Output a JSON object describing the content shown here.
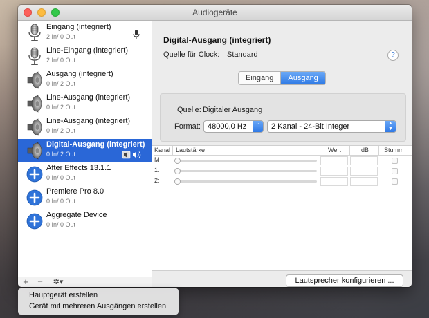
{
  "window": {
    "title": "Audiogeräte"
  },
  "devices": [
    {
      "name": "Eingang (integriert)",
      "io": "2 In/ 0 Out",
      "icon": "microphone-icon"
    },
    {
      "name": "Line-Eingang (integriert)",
      "io": "2 In/ 0 Out",
      "icon": "microphone-icon"
    },
    {
      "name": "Ausgang (integriert)",
      "io": "0 In/ 2 Out",
      "icon": "speaker-icon"
    },
    {
      "name": "Line-Ausgang (integriert)",
      "io": "0 In/ 2 Out",
      "icon": "speaker-icon"
    },
    {
      "name": "Line-Ausgang (integriert)",
      "io": "0 In/ 2 Out",
      "icon": "speaker-icon"
    },
    {
      "name": "Digital-Ausgang (integriert)",
      "io": "0 In/ 2 Out",
      "icon": "speaker-icon",
      "selected": true
    },
    {
      "name": "After Effects 13.1.1",
      "io": "0 In/ 0 Out",
      "icon": "plus-circle-icon"
    },
    {
      "name": "Premiere Pro 8.0",
      "io": "0 In/ 0 Out",
      "icon": "plus-circle-icon"
    },
    {
      "name": "Aggregate Device",
      "io": "0 In/ 0 Out",
      "icon": "plus-circle-icon"
    }
  ],
  "sidebar_bottom": {
    "add": "+",
    "remove": "−",
    "gear": "✲▾"
  },
  "detail": {
    "title": "Digital-Ausgang (integriert)",
    "clock_label": "Quelle für Clock:",
    "clock_value": "Standard",
    "help": "?",
    "tabs": [
      "Eingang",
      "Ausgang"
    ],
    "active_tab": "Ausgang",
    "source_label": "Quelle:",
    "source_value": "Digitaler Ausgang",
    "format_label": "Format:",
    "sample_rate": "48000,0 Hz",
    "channel_format": "2 Kanal - 24-Bit Integer"
  },
  "volume_table": {
    "headers": {
      "kanal": "Kanal",
      "lautstaerke": "Lautstärke",
      "wert": "Wert",
      "db": "dB",
      "stumm": "Stumm"
    },
    "rows": [
      {
        "label": "M"
      },
      {
        "label": "1:"
      },
      {
        "label": "2:"
      }
    ]
  },
  "config_button": "Lautsprecher konfigurieren ...",
  "context_menu": {
    "items": [
      "Hauptgerät erstellen",
      "Gerät mit mehreren Ausgängen erstellen"
    ]
  }
}
